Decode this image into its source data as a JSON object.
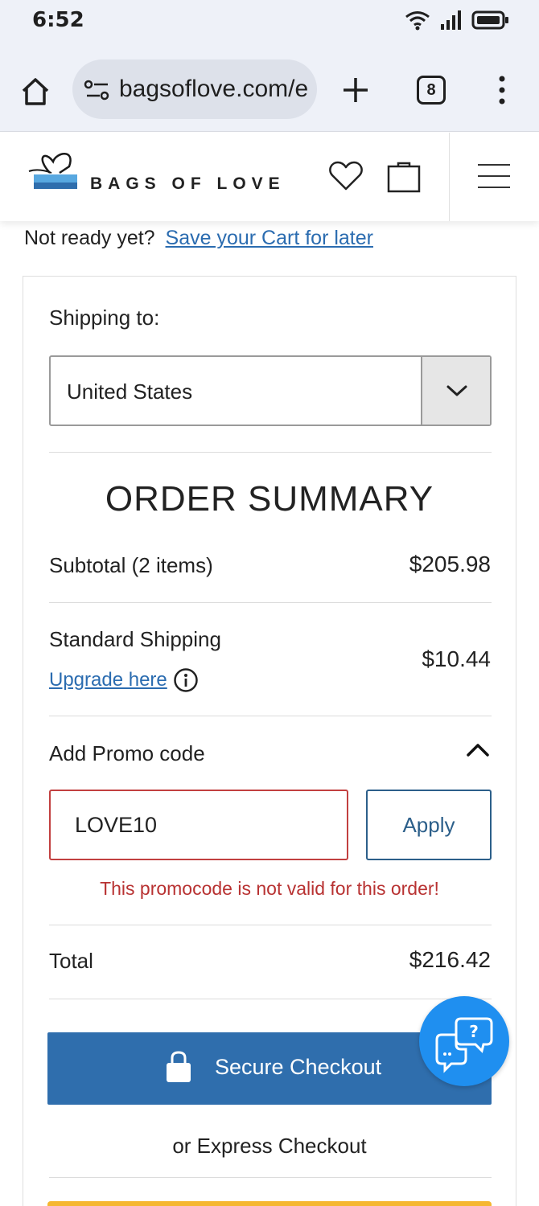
{
  "status_bar": {
    "time": "6:52"
  },
  "browser": {
    "url": "bagsoflove.com/e",
    "tab_count": "8"
  },
  "header": {
    "brand": "BAGS OF LOVE"
  },
  "save_cart": {
    "prefix": "Not ready yet?",
    "link": "Save your Cart for later"
  },
  "shipping": {
    "label": "Shipping to:",
    "country": "United States"
  },
  "summary": {
    "title": "ORDER SUMMARY",
    "subtotal_label": "Subtotal (2 items)",
    "subtotal_value": "$205.98",
    "shipping_label": "Standard Shipping",
    "upgrade_link": "Upgrade here",
    "shipping_value": "$10.44",
    "promo_label": "Add Promo code",
    "promo_value": "LOVE10",
    "apply_label": "Apply",
    "promo_error": "This promocode is not valid for this order!",
    "total_label": "Total",
    "total_value": "$216.42"
  },
  "checkout": {
    "secure_label": "Secure Checkout",
    "express_label": "or Express Checkout"
  },
  "colors": {
    "accent_blue": "#2f6ead",
    "link_blue": "#2b6cb0",
    "error_red": "#c24040",
    "chat_blue": "#1f8ff0",
    "paypal_yellow": "#f5b731"
  }
}
